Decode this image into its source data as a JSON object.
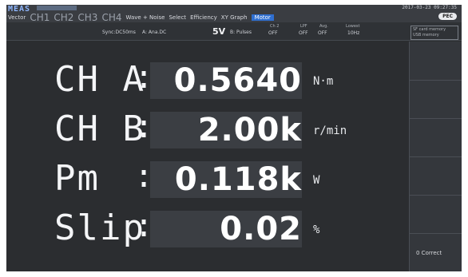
{
  "header": {
    "title": "MEAS",
    "datetime": "2017-03-23 09:27:35",
    "tabs": [
      {
        "label": "Vector",
        "active": false
      },
      {
        "label": "CH1",
        "active": false
      },
      {
        "label": "CH2",
        "active": false
      },
      {
        "label": "CH3",
        "active": false
      },
      {
        "label": "CH4",
        "active": false
      },
      {
        "label": "Wave + Noise",
        "active": false
      },
      {
        "label": "Select",
        "active": false
      },
      {
        "label": "Efficiency",
        "active": false
      },
      {
        "label": "XY Graph",
        "active": false
      },
      {
        "label": "Motor",
        "active": true
      }
    ],
    "pec_badge": "PEC"
  },
  "settings": {
    "sync": "Sync:DC50ms",
    "channel_a": "A: Ana.DC",
    "range": "5V",
    "channel_b": "B: Pulses",
    "ch2_label": "Ch 2",
    "ch2_value": "OFF",
    "lpf_label": "LPF",
    "lpf_value": "OFF",
    "avg_label": "Avg.",
    "avg_value": "OFF",
    "lowest_label": "Lowest",
    "lowest_value": "10Hz",
    "side_note_1": "SF card memory",
    "side_note_2": "USB memory"
  },
  "measurements": [
    {
      "label": "CH A",
      "value": "0.5640",
      "unit": "N·m"
    },
    {
      "label": "CH B",
      "value": "2.00k",
      "unit": "r/min"
    },
    {
      "label": "Pm  ",
      "value": "0.118k",
      "unit": "W"
    },
    {
      "label": "Slip",
      "value": "0.02",
      "unit": "%"
    }
  ],
  "right_panel": {
    "zero_correct_label": "0 Correct"
  },
  "colors": {
    "screen_bg": "#2b2d30",
    "accent_tab": "#2f6fd0",
    "value_text": "#ffffff"
  }
}
